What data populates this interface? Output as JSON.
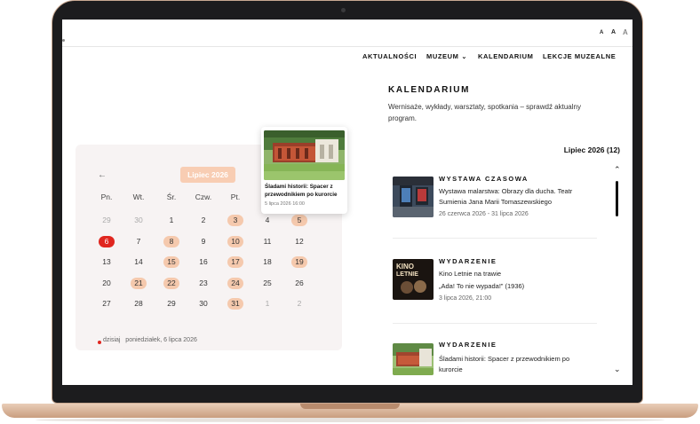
{
  "header": {
    "text_size_small": "A",
    "text_size_medium": "A",
    "text_size_large": "A"
  },
  "nav": {
    "items": [
      "AKTUALNOŚCI",
      "MUZEUM",
      "KALENDARIUM",
      "LEKCJE MUZEALNE"
    ],
    "museum_chevron_icon": "chevron-down"
  },
  "kalendarium": {
    "title": "KALENDARIUM",
    "description": "Wernisaże, wykłady, warsztaty, spotkania – sprawdź aktualny program.",
    "month_count": "Lipiec 2026 (12)"
  },
  "events": [
    {
      "category": "WYSTAWA CZASOWA",
      "title_line1": "Wystawa malarstwa: Obrazy dla ducha. Teatr",
      "title_line2": "Sumienia Jana Marii Tomaszewskiego",
      "date": "26 czerwca 2026 - 31 lipca 2026"
    },
    {
      "category": "WYDARZENIE",
      "title_line1": "Kino Letnie na trawie",
      "title_line2": "„Ada! To nie wypada!” (1936)",
      "date": "3 lipca 2026, 21:00"
    },
    {
      "category": "WYDARZENIE",
      "title_line1": "Śladami historii: Spacer z przewodnikiem po",
      "title_line2": "kurorcie"
    }
  ],
  "calendar": {
    "prev_icon": "arrow-left",
    "month_label": "Lipiec 2026",
    "weekdays": [
      "Pn.",
      "Wt.",
      "Śr.",
      "Czw.",
      "Pt.",
      "",
      ""
    ],
    "weeks": [
      [
        {
          "d": "29",
          "s": "out"
        },
        {
          "d": "30",
          "s": "out"
        },
        {
          "d": "1",
          "s": "norm"
        },
        {
          "d": "2",
          "s": "norm"
        },
        {
          "d": "3",
          "s": "ev"
        },
        {
          "d": "4",
          "s": "norm"
        },
        {
          "d": "5",
          "s": "ev"
        }
      ],
      [
        {
          "d": "6",
          "s": "today"
        },
        {
          "d": "7",
          "s": "norm"
        },
        {
          "d": "8",
          "s": "ev"
        },
        {
          "d": "9",
          "s": "norm"
        },
        {
          "d": "10",
          "s": "ev"
        },
        {
          "d": "11",
          "s": "norm"
        },
        {
          "d": "12",
          "s": "norm"
        }
      ],
      [
        {
          "d": "13",
          "s": "norm"
        },
        {
          "d": "14",
          "s": "norm"
        },
        {
          "d": "15",
          "s": "ev"
        },
        {
          "d": "16",
          "s": "norm"
        },
        {
          "d": "17",
          "s": "ev"
        },
        {
          "d": "18",
          "s": "norm"
        },
        {
          "d": "19",
          "s": "ev"
        }
      ],
      [
        {
          "d": "20",
          "s": "norm"
        },
        {
          "d": "21",
          "s": "ev"
        },
        {
          "d": "22",
          "s": "ev"
        },
        {
          "d": "23",
          "s": "norm"
        },
        {
          "d": "24",
          "s": "ev"
        },
        {
          "d": "25",
          "s": "norm"
        },
        {
          "d": "26",
          "s": "norm"
        }
      ],
      [
        {
          "d": "27",
          "s": "norm"
        },
        {
          "d": "28",
          "s": "norm"
        },
        {
          "d": "29",
          "s": "norm"
        },
        {
          "d": "30",
          "s": "norm"
        },
        {
          "d": "31",
          "s": "ev"
        },
        {
          "d": "1",
          "s": "out"
        },
        {
          "d": "2",
          "s": "out"
        }
      ]
    ],
    "legend_today": "dzisiaj",
    "legend_date": "poniedziałek, 6 lipca 2026"
  },
  "popup": {
    "title": "Śladami historii: Spacer z przewodnikiem po kurorcie",
    "date": "5 lipca 2026 16:00"
  },
  "colors": {
    "accent_peach": "#f5c9ad",
    "today_red": "#e0261f",
    "laptop_gold": "#d9b39a"
  }
}
